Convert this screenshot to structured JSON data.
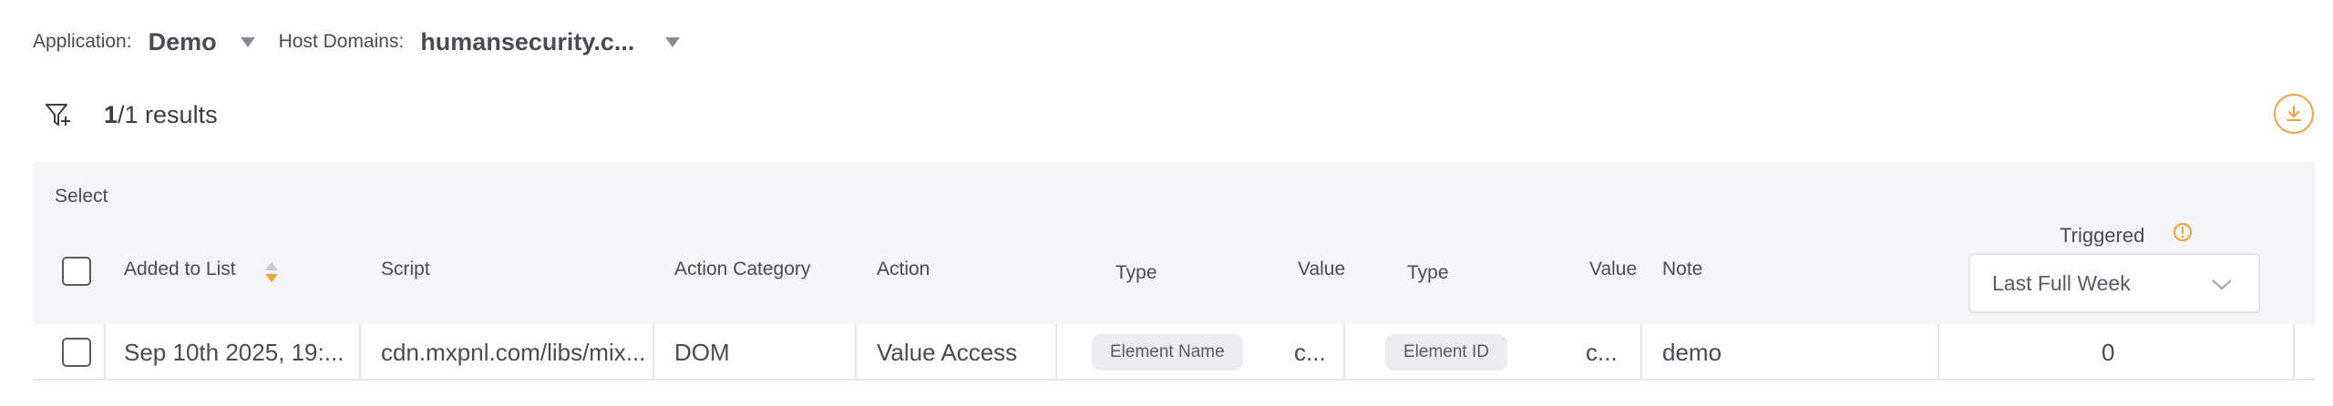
{
  "filters": {
    "application_label": "Application:",
    "application_value": "Demo",
    "host_domains_label": "Host Domains:",
    "host_domains_value": "humansecurity.c..."
  },
  "results": {
    "current": "1",
    "total_text": "/1 results"
  },
  "table": {
    "select_label": "Select",
    "headers": {
      "added_to_list": "Added to List",
      "script": "Script",
      "action_category": "Action Category",
      "action": "Action",
      "type1": "Type",
      "value1": "Value",
      "type2": "Type",
      "value2": "Value",
      "note": "Note",
      "triggered": "Triggered"
    },
    "triggered_filter": "Last Full Week",
    "rows": [
      {
        "added": "Sep 10th 2025, 19:...",
        "script": "cdn.mxpnl.com/libs/mix...",
        "action_category": "DOM",
        "action": "Value Access",
        "type1": "Element Name",
        "value1": "c...",
        "type2": "Element ID",
        "value2": "c...",
        "note": "demo",
        "triggered": "0"
      }
    ]
  },
  "colors": {
    "accent": "#f0a040",
    "header_bg": "#f5f5f7"
  },
  "icons": {
    "filter": "filter-add-icon",
    "download": "download-icon",
    "info": "info-icon",
    "sort": "sort-icon",
    "chevron": "chevron-down-icon"
  }
}
